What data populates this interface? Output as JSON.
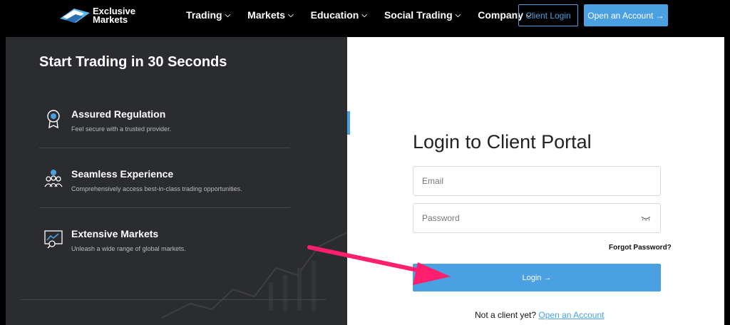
{
  "nav": {
    "logo_line1": "Exclusive",
    "logo_line2": "Markets",
    "items": [
      {
        "label": "Trading"
      },
      {
        "label": "Markets"
      },
      {
        "label": "Education"
      },
      {
        "label": "Social Trading"
      },
      {
        "label": "Company"
      }
    ],
    "client_login": "Client Login",
    "open_account": "Open an Account →"
  },
  "left": {
    "title": "Start Trading in 30 Seconds",
    "features": [
      {
        "title": "Assured Regulation",
        "subtitle": "Feel secure with a trusted provider.",
        "icon": "medal-icon"
      },
      {
        "title": "Seamless Experience",
        "subtitle": "Comprehensively access best-in-class trading opportunities.",
        "icon": "users-icon"
      },
      {
        "title": "Extensive Markets",
        "subtitle": "Unleash a wide range of global markets.",
        "icon": "chart-monitor-icon"
      }
    ]
  },
  "login": {
    "title": "Login to Client Portal",
    "email_placeholder": "Email",
    "password_placeholder": "Password",
    "forgot": "Forgot Password?",
    "submit": "Login →",
    "not_client": "Not a client yet?",
    "open_account_link": "Open an Account"
  },
  "colors": {
    "accent": "#4aa0e0",
    "arrow": "#ff1f6d",
    "panel": "#2b2c2f"
  }
}
